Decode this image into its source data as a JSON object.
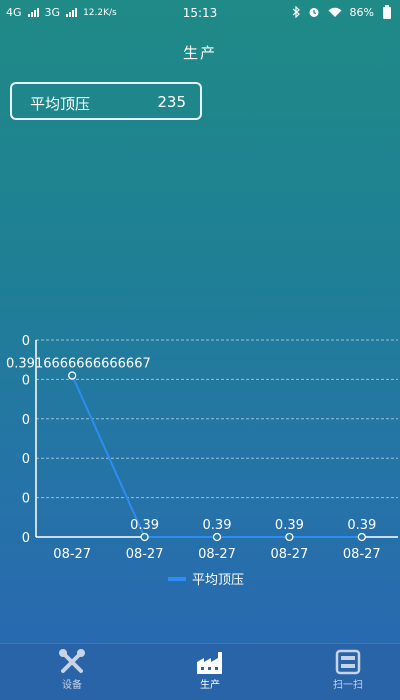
{
  "status": {
    "net1": "4G",
    "net2": "3G",
    "speed": "12.2K/s",
    "time": "15:13",
    "battery": "86%",
    "icons": [
      "bluetooth-icon",
      "alarm-icon",
      "wifi-icon",
      "battery-icon"
    ]
  },
  "header": {
    "title": "生产"
  },
  "stat": {
    "label": "平均顶压",
    "value": "235"
  },
  "chart_data": {
    "type": "line",
    "x": [
      "08-27",
      "08-27",
      "08-27",
      "08-27",
      "08-27"
    ],
    "series": [
      {
        "name": "平均顶压",
        "values": [
          0.3916666666666667,
          0.39,
          0.39,
          0.39,
          0.39
        ],
        "labels": [
          "0.3916666666666667",
          "0.39",
          "0.39",
          "0.39",
          "0.39"
        ],
        "color": "#2f8cf0"
      }
    ],
    "ytick_labels": [
      "0",
      "0",
      "0",
      "0",
      "0",
      "0"
    ],
    "grid": true,
    "legend": "bottom"
  },
  "tabs": [
    {
      "label": "设备",
      "icon": "tools-icon"
    },
    {
      "label": "生产",
      "icon": "factory-icon",
      "active": true
    },
    {
      "label": "扫一扫",
      "icon": "scan-icon"
    }
  ]
}
